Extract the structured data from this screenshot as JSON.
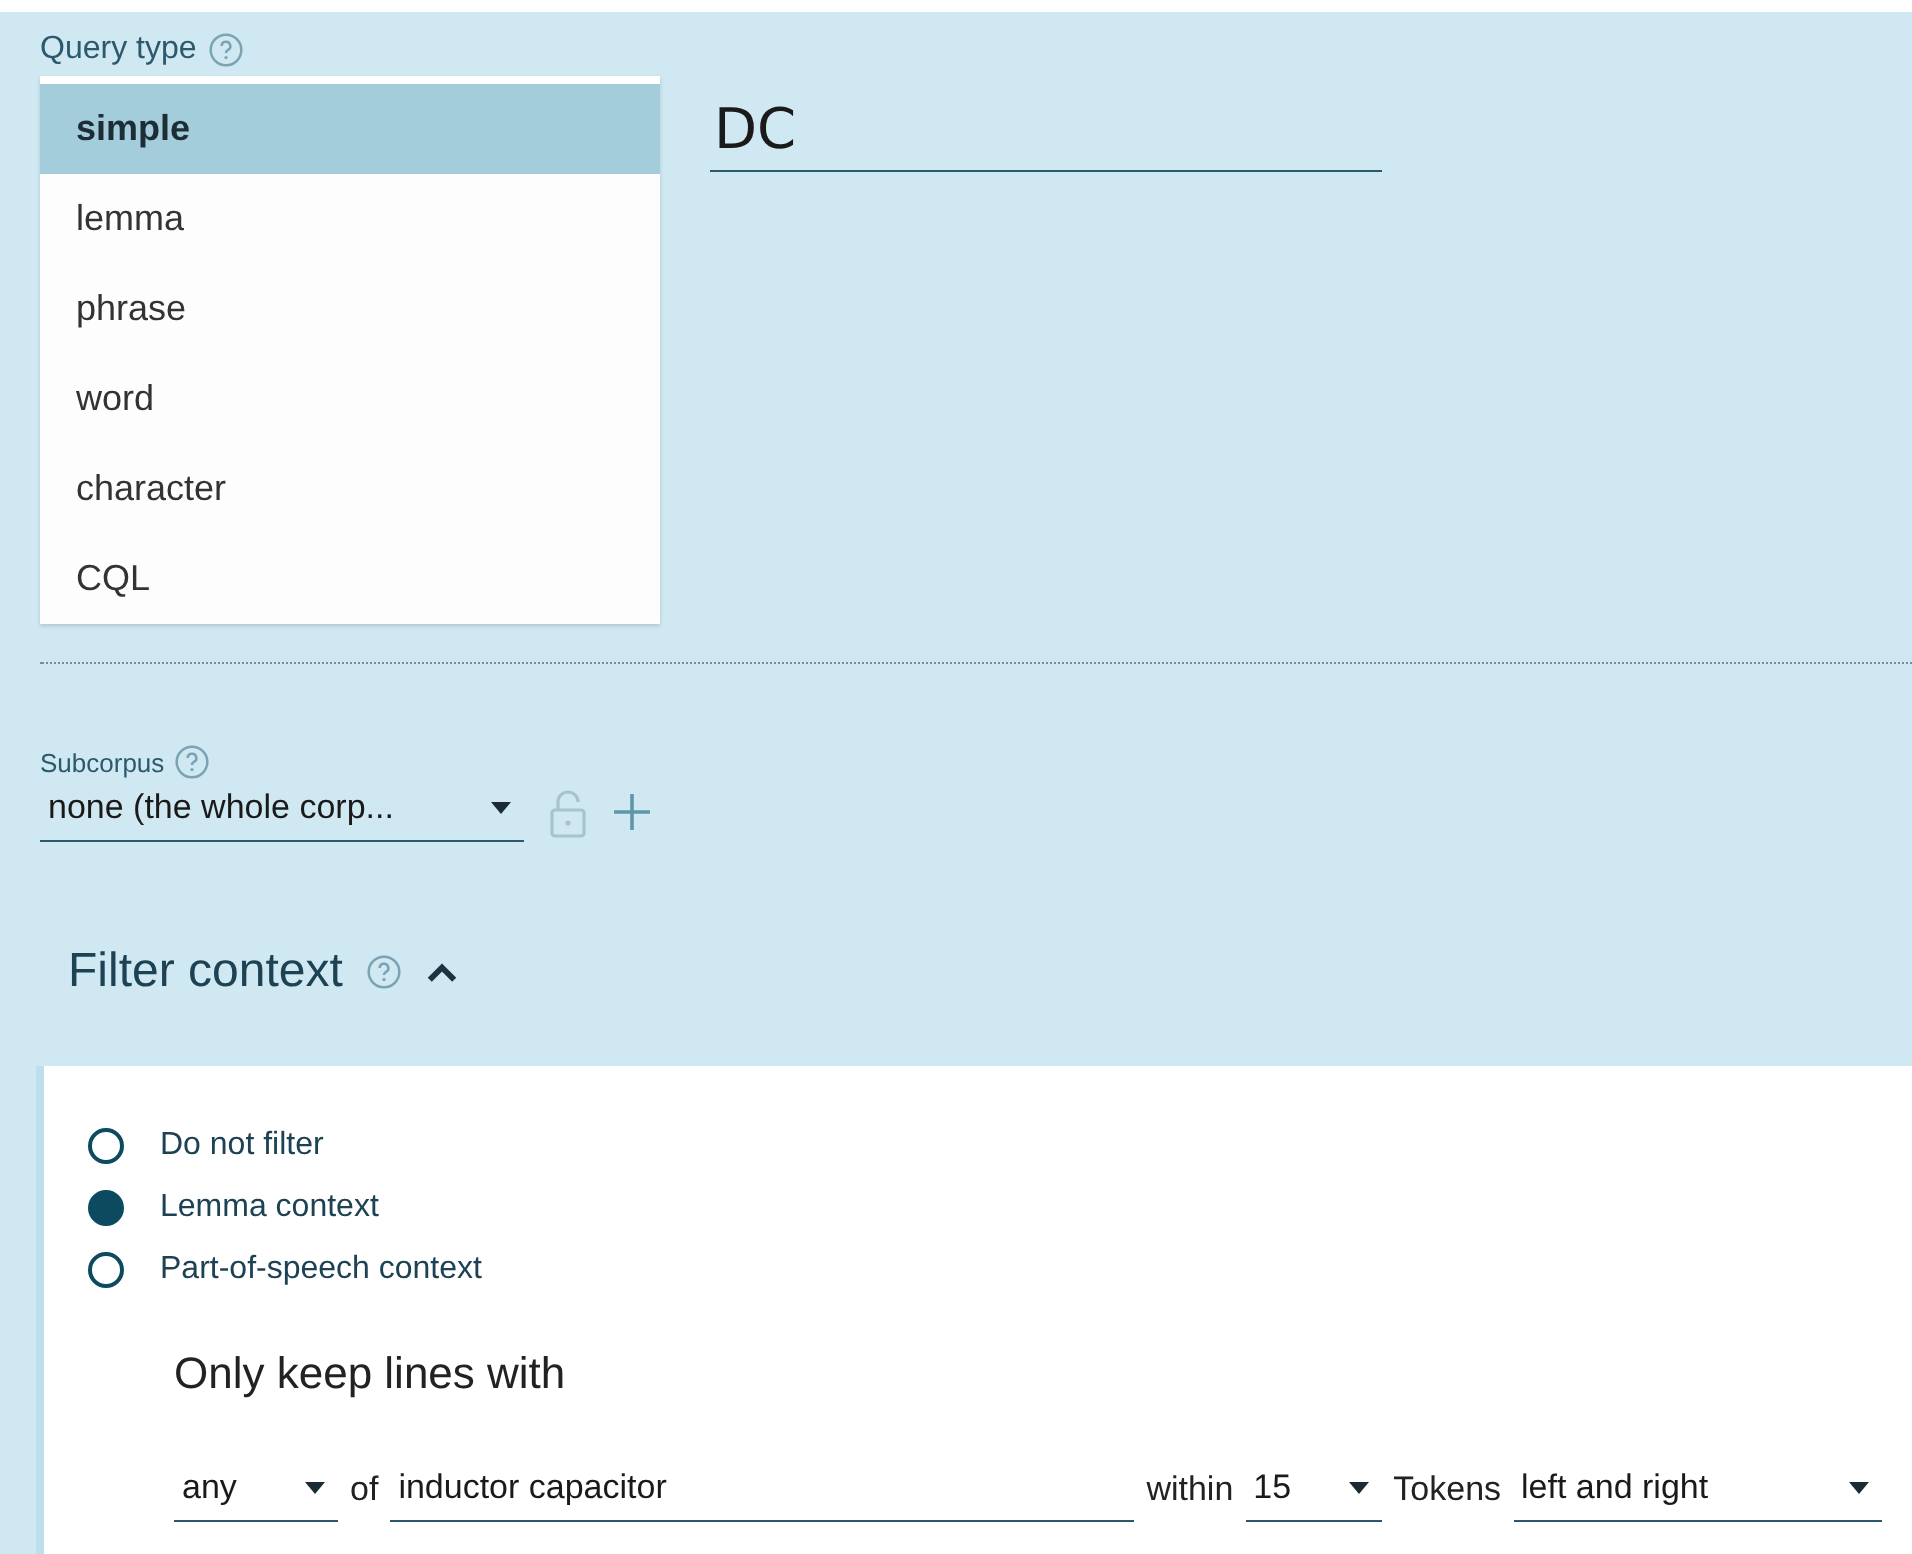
{
  "query_type": {
    "label": "Query type",
    "options": [
      {
        "label": "simple",
        "selected": true
      },
      {
        "label": "lemma",
        "selected": false
      },
      {
        "label": "phrase",
        "selected": false
      },
      {
        "label": "word",
        "selected": false
      },
      {
        "label": "character",
        "selected": false
      },
      {
        "label": "CQL",
        "selected": false
      }
    ]
  },
  "query": {
    "value": "DC"
  },
  "subcorpus": {
    "label": "Subcorpus",
    "value": "none (the whole corp..."
  },
  "filter_context": {
    "title": "Filter context",
    "expanded": true,
    "options": [
      {
        "label": "Do not filter",
        "selected": false
      },
      {
        "label": "Lemma context",
        "selected": true
      },
      {
        "label": "Part-of-speech context",
        "selected": false
      }
    ],
    "heading": "Only keep lines with",
    "quantifier": "any",
    "of_label": "of",
    "lemmas": "inductor capacitor",
    "within_label": "within",
    "distance": "15",
    "tokens_label": "Tokens",
    "direction": "left and right"
  }
}
